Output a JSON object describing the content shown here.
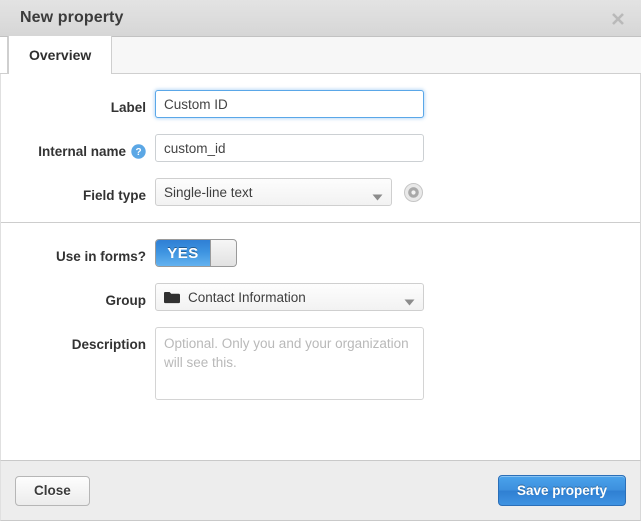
{
  "dialog": {
    "title": "New property",
    "close_icon": "close-icon"
  },
  "tabs": [
    {
      "label": "Overview",
      "active": true
    }
  ],
  "form": {
    "sections": [
      {
        "fields": [
          {
            "label": "Label",
            "type": "text",
            "value": "Custom ID",
            "placeholder": "",
            "focused": true
          },
          {
            "label": "Internal name",
            "type": "text",
            "value": "custom_id",
            "placeholder": "",
            "help_icon": "help-icon",
            "help_tooltip": "Internal name"
          },
          {
            "label": "Field type",
            "type": "select",
            "value": "Single-line text",
            "trailing_icon": "gear-icon"
          }
        ]
      },
      {
        "fields": [
          {
            "label": "Use in forms?",
            "type": "toggle",
            "value": "YES",
            "on": true
          },
          {
            "label": "Group",
            "type": "select",
            "value": "Contact Information",
            "leading_icon": "folder-icon"
          },
          {
            "label": "Description",
            "type": "textarea",
            "value": "",
            "placeholder": "Optional. Only you and your organization will see this."
          }
        ]
      }
    ]
  },
  "footer": {
    "close_label": "Close",
    "save_label": "Save property"
  },
  "colors": {
    "accent": "#3c8fdd",
    "titlebar": "#dcdcdc",
    "footer": "#ededed",
    "focus_border": "#5aa7e8",
    "help_blue": "#5ba7e5"
  }
}
